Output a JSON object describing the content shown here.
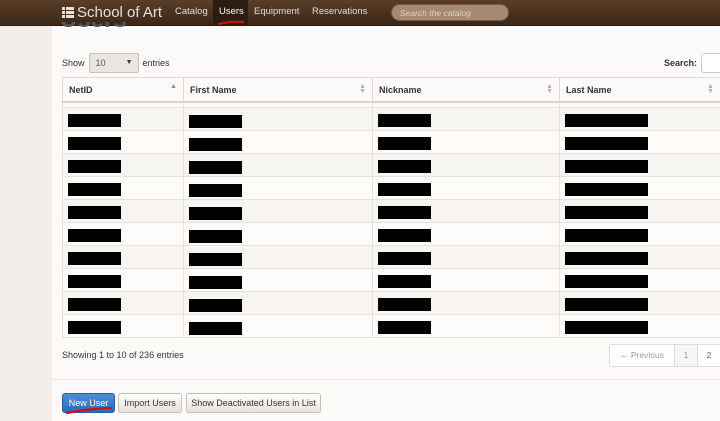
{
  "navbar": {
    "brand": "School of Art",
    "links": [
      "Catalog",
      "Users",
      "Equipment",
      "Reservations"
    ],
    "active": "Users",
    "search_placeholder": "Search the catalog"
  },
  "page": {
    "length_label_before": "Show",
    "length_value": "10",
    "length_label_after": "entries",
    "search_label": "Search:"
  },
  "table": {
    "columns": [
      "NetID",
      "First Name",
      "Nickname",
      "Last Name"
    ],
    "sort_column": "NetID",
    "sort_direction": "ascending"
  },
  "info": "Showing 1 to 10 of 236 entries",
  "pagination": {
    "previous": "← Previous",
    "pages": [
      "1",
      "2"
    ],
    "current": "1"
  },
  "buttons": {
    "new_user": "New User",
    "import_users": "Import Users",
    "show_deactivated": "Show Deactivated Users in List"
  },
  "colors": {
    "navbar": "#4a3120",
    "primary_button": "#3a7bc8",
    "annotation": "#d01010"
  }
}
